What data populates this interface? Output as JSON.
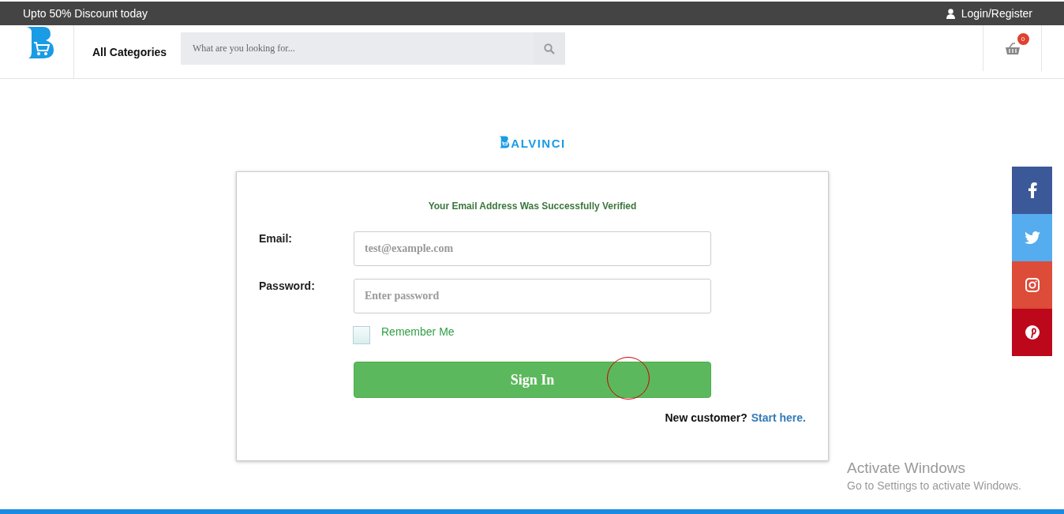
{
  "top_bar": {
    "promo": "Upto 50% Discount today",
    "login": "Login/Register"
  },
  "header": {
    "categories": "All Categories",
    "search": {
      "placeholder": "What are you looking for..."
    },
    "cart": {
      "count": "0"
    }
  },
  "brand": {
    "name": "ALVINCI"
  },
  "login_form": {
    "message": "Your Email Address Was Successfully Verified",
    "fields": [
      {
        "label": "Email:",
        "placeholder": "test@example.com"
      },
      {
        "label": "Password:",
        "placeholder": "Enter password"
      }
    ],
    "remember": {
      "label": "Remember Me",
      "checked": false
    },
    "submit": "Sign In",
    "signup": {
      "prompt": "New customer?",
      "link": "Start here."
    }
  },
  "social": [
    {
      "kind": "facebook",
      "color": "#3b5998"
    },
    {
      "kind": "twitter",
      "color": "#55acee"
    },
    {
      "kind": "instagram",
      "color": "#dd4b39"
    },
    {
      "kind": "pinterest",
      "color": "#bd081c"
    }
  ],
  "os_overlay": {
    "title": "Activate Windows",
    "text": "Go to Settings to activate Windows."
  }
}
